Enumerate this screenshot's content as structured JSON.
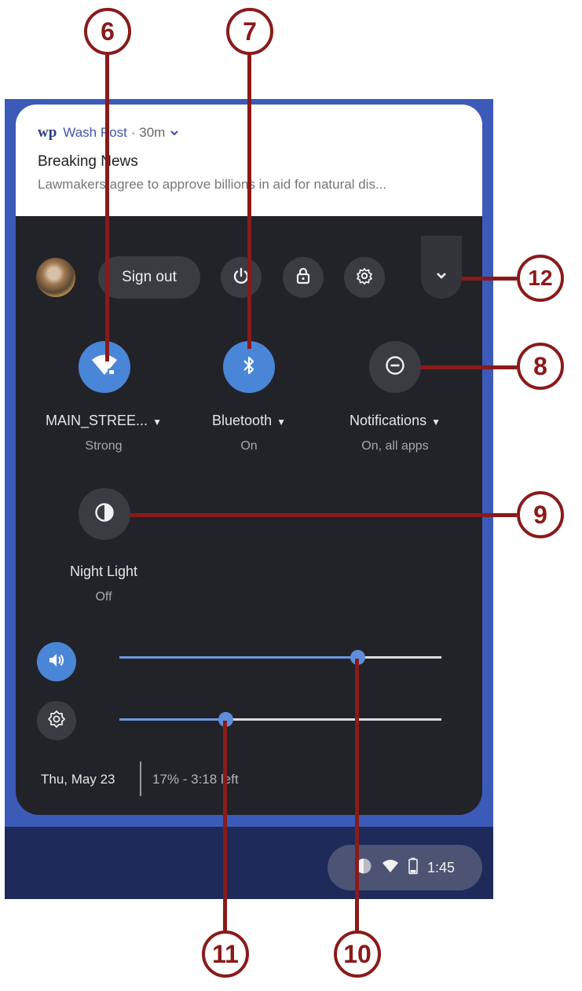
{
  "notification": {
    "app_logo": "wp",
    "app_name": "Wash Post",
    "meta": "· 30m",
    "expand_icon": "chevron-down-icon",
    "title": "Breaking News",
    "body": "Lawmakers agree to approve billions in aid for natural dis..."
  },
  "top_row": {
    "sign_out_label": "Sign out",
    "power_icon": "power-icon",
    "lock_icon": "lock-icon",
    "settings_icon": "gear-icon",
    "collapse_icon": "chevron-down-icon"
  },
  "tiles": [
    {
      "label": "MAIN_STREE...",
      "status": "Strong",
      "icon": "wifi-icon",
      "state": "on"
    },
    {
      "label": "Bluetooth",
      "status": "On",
      "icon": "bluetooth-icon",
      "state": "on"
    },
    {
      "label": "Notifications",
      "status": "On, all apps",
      "icon": "do-not-disturb-icon",
      "state": "off"
    },
    {
      "label": "Night Light",
      "status": "Off",
      "icon": "night-light-icon",
      "state": "off"
    }
  ],
  "sliders": {
    "volume": {
      "icon": "volume-icon",
      "level": 0.74
    },
    "brightness": {
      "icon": "brightness-icon",
      "level": 0.33
    }
  },
  "footer": {
    "date": "Thu, May 23",
    "battery": "17% - 3:18 left"
  },
  "shelf": {
    "time": "1:45",
    "icons": [
      "profile-icon",
      "wifi-icon",
      "battery-icon"
    ]
  },
  "callouts": [
    "6",
    "7",
    "8",
    "9",
    "10",
    "11",
    "12"
  ],
  "colors": {
    "accent": "#4a86d8",
    "panel_bg": "#222328",
    "callout": "#8a1a1a"
  }
}
